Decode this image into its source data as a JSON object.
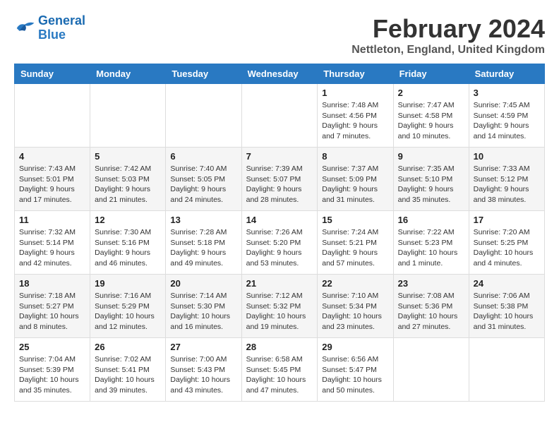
{
  "header": {
    "logo_line1": "General",
    "logo_line2": "Blue",
    "month": "February 2024",
    "location": "Nettleton, England, United Kingdom"
  },
  "days_of_week": [
    "Sunday",
    "Monday",
    "Tuesday",
    "Wednesday",
    "Thursday",
    "Friday",
    "Saturday"
  ],
  "weeks": [
    [
      {
        "day": "",
        "info": ""
      },
      {
        "day": "",
        "info": ""
      },
      {
        "day": "",
        "info": ""
      },
      {
        "day": "",
        "info": ""
      },
      {
        "day": "1",
        "info": "Sunrise: 7:48 AM\nSunset: 4:56 PM\nDaylight: 9 hours\nand 7 minutes."
      },
      {
        "day": "2",
        "info": "Sunrise: 7:47 AM\nSunset: 4:58 PM\nDaylight: 9 hours\nand 10 minutes."
      },
      {
        "day": "3",
        "info": "Sunrise: 7:45 AM\nSunset: 4:59 PM\nDaylight: 9 hours\nand 14 minutes."
      }
    ],
    [
      {
        "day": "4",
        "info": "Sunrise: 7:43 AM\nSunset: 5:01 PM\nDaylight: 9 hours\nand 17 minutes."
      },
      {
        "day": "5",
        "info": "Sunrise: 7:42 AM\nSunset: 5:03 PM\nDaylight: 9 hours\nand 21 minutes."
      },
      {
        "day": "6",
        "info": "Sunrise: 7:40 AM\nSunset: 5:05 PM\nDaylight: 9 hours\nand 24 minutes."
      },
      {
        "day": "7",
        "info": "Sunrise: 7:39 AM\nSunset: 5:07 PM\nDaylight: 9 hours\nand 28 minutes."
      },
      {
        "day": "8",
        "info": "Sunrise: 7:37 AM\nSunset: 5:09 PM\nDaylight: 9 hours\nand 31 minutes."
      },
      {
        "day": "9",
        "info": "Sunrise: 7:35 AM\nSunset: 5:10 PM\nDaylight: 9 hours\nand 35 minutes."
      },
      {
        "day": "10",
        "info": "Sunrise: 7:33 AM\nSunset: 5:12 PM\nDaylight: 9 hours\nand 38 minutes."
      }
    ],
    [
      {
        "day": "11",
        "info": "Sunrise: 7:32 AM\nSunset: 5:14 PM\nDaylight: 9 hours\nand 42 minutes."
      },
      {
        "day": "12",
        "info": "Sunrise: 7:30 AM\nSunset: 5:16 PM\nDaylight: 9 hours\nand 46 minutes."
      },
      {
        "day": "13",
        "info": "Sunrise: 7:28 AM\nSunset: 5:18 PM\nDaylight: 9 hours\nand 49 minutes."
      },
      {
        "day": "14",
        "info": "Sunrise: 7:26 AM\nSunset: 5:20 PM\nDaylight: 9 hours\nand 53 minutes."
      },
      {
        "day": "15",
        "info": "Sunrise: 7:24 AM\nSunset: 5:21 PM\nDaylight: 9 hours\nand 57 minutes."
      },
      {
        "day": "16",
        "info": "Sunrise: 7:22 AM\nSunset: 5:23 PM\nDaylight: 10 hours\nand 1 minute."
      },
      {
        "day": "17",
        "info": "Sunrise: 7:20 AM\nSunset: 5:25 PM\nDaylight: 10 hours\nand 4 minutes."
      }
    ],
    [
      {
        "day": "18",
        "info": "Sunrise: 7:18 AM\nSunset: 5:27 PM\nDaylight: 10 hours\nand 8 minutes."
      },
      {
        "day": "19",
        "info": "Sunrise: 7:16 AM\nSunset: 5:29 PM\nDaylight: 10 hours\nand 12 minutes."
      },
      {
        "day": "20",
        "info": "Sunrise: 7:14 AM\nSunset: 5:30 PM\nDaylight: 10 hours\nand 16 minutes."
      },
      {
        "day": "21",
        "info": "Sunrise: 7:12 AM\nSunset: 5:32 PM\nDaylight: 10 hours\nand 19 minutes."
      },
      {
        "day": "22",
        "info": "Sunrise: 7:10 AM\nSunset: 5:34 PM\nDaylight: 10 hours\nand 23 minutes."
      },
      {
        "day": "23",
        "info": "Sunrise: 7:08 AM\nSunset: 5:36 PM\nDaylight: 10 hours\nand 27 minutes."
      },
      {
        "day": "24",
        "info": "Sunrise: 7:06 AM\nSunset: 5:38 PM\nDaylight: 10 hours\nand 31 minutes."
      }
    ],
    [
      {
        "day": "25",
        "info": "Sunrise: 7:04 AM\nSunset: 5:39 PM\nDaylight: 10 hours\nand 35 minutes."
      },
      {
        "day": "26",
        "info": "Sunrise: 7:02 AM\nSunset: 5:41 PM\nDaylight: 10 hours\nand 39 minutes."
      },
      {
        "day": "27",
        "info": "Sunrise: 7:00 AM\nSunset: 5:43 PM\nDaylight: 10 hours\nand 43 minutes."
      },
      {
        "day": "28",
        "info": "Sunrise: 6:58 AM\nSunset: 5:45 PM\nDaylight: 10 hours\nand 47 minutes."
      },
      {
        "day": "29",
        "info": "Sunrise: 6:56 AM\nSunset: 5:47 PM\nDaylight: 10 hours\nand 50 minutes."
      },
      {
        "day": "",
        "info": ""
      },
      {
        "day": "",
        "info": ""
      }
    ]
  ]
}
